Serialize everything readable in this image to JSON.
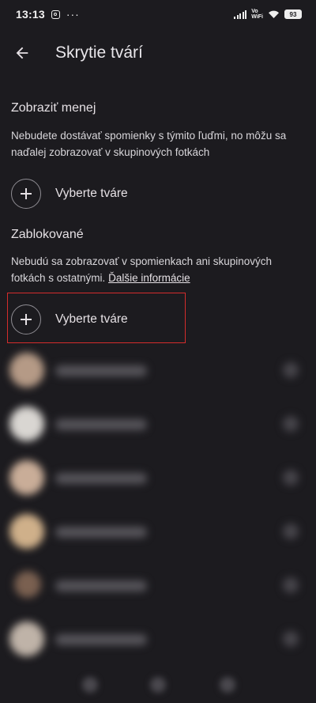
{
  "status_bar": {
    "time": "13:13",
    "vo_label": "Vo",
    "wifi_label": "WiFi",
    "battery": "93"
  },
  "app_bar": {
    "title": "Skrytie tvárí"
  },
  "show_less": {
    "heading": "Zobraziť menej",
    "description": "Nebudete dostávať spomienky s týmito ľuďmi, no môžu sa naďalej zobrazovať v skupinových fotkách",
    "add_label": "Vyberte tváre"
  },
  "blocked": {
    "heading": "Zablokované",
    "description": "Nebudú sa zobrazovať v spomienkach ani skupinových fotkách s ostatnými.",
    "link": "Ďalšie informácie",
    "add_label": "Vyberte tváre"
  },
  "colors": {
    "background": "#1c1b1f",
    "highlight_border": "#d42c2c"
  },
  "icons": {
    "back": "arrow-left-icon",
    "add": "plus-icon"
  }
}
